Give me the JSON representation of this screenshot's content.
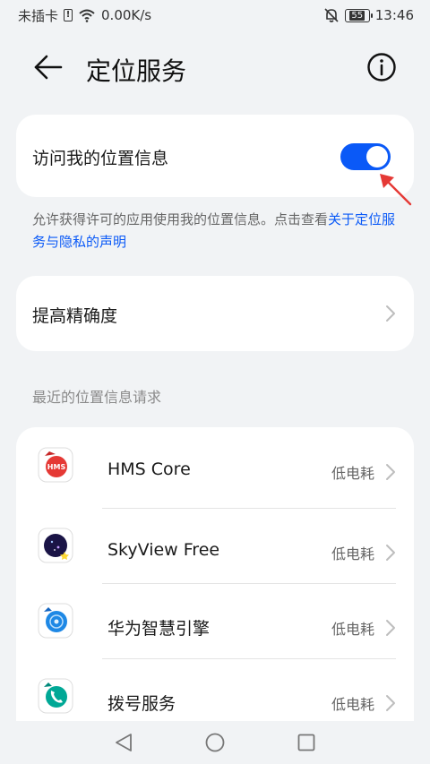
{
  "status_bar": {
    "carrier": "未插卡",
    "speed": "0.00K/s",
    "battery": "55",
    "time": "13:46",
    "icons": [
      "sim-alert-icon",
      "wifi-icon",
      "mute-bell-icon",
      "battery-icon"
    ]
  },
  "header": {
    "back_icon": "arrow-left-icon",
    "title": "定位服务",
    "info_icon": "info-circle-icon"
  },
  "location_card": {
    "label": "访问我的位置信息",
    "toggle_on": true,
    "accent_color": "#0a59f7",
    "annotation": "red-arrow-icon"
  },
  "description": {
    "text": "允许获得许可的应用使用我的位置信息。点击查看",
    "link": "关于定位服务与隐私的声明"
  },
  "accuracy_card": {
    "label": "提高精确度"
  },
  "recent_section": {
    "title": "最近的位置信息请求",
    "items": [
      {
        "name": "HMS Core",
        "power": "低电耗",
        "icon": "hms-core-icon"
      },
      {
        "name": "SkyView Free",
        "power": "低电耗",
        "icon": "skyview-icon"
      },
      {
        "name": "华为智慧引擎",
        "power": "低电耗",
        "icon": "huawei-engine-icon"
      },
      {
        "name": "拨号服务",
        "power": "低电耗",
        "icon": "dialer-icon"
      }
    ]
  },
  "nav_bar": {
    "icons": [
      "nav-back-icon",
      "nav-home-icon",
      "nav-recent-icon"
    ]
  }
}
